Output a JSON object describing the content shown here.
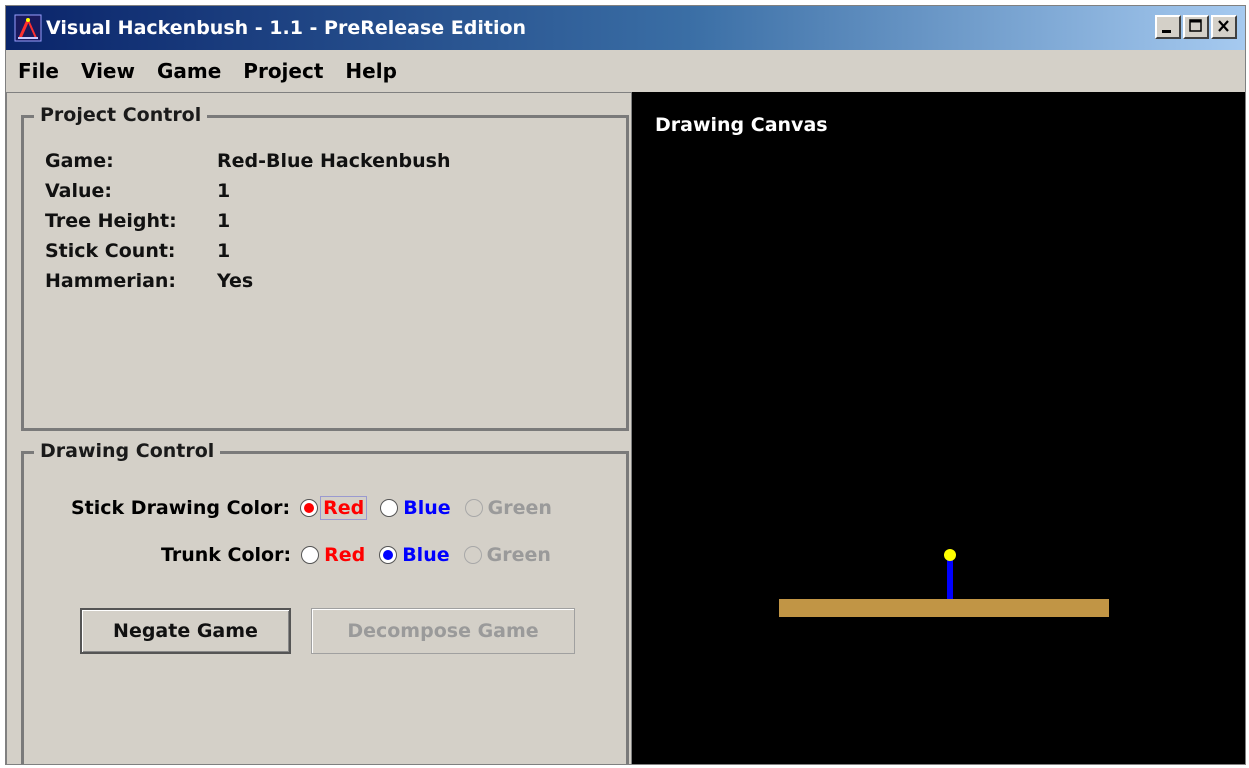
{
  "window": {
    "title": "Visual Hackenbush - 1.1 - PreRelease Edition"
  },
  "menu": {
    "items": [
      {
        "label": "File"
      },
      {
        "label": "View"
      },
      {
        "label": "Game"
      },
      {
        "label": "Project"
      },
      {
        "label": "Help"
      }
    ]
  },
  "project_control": {
    "title": "Project Control",
    "rows": [
      {
        "label": "Game:",
        "value": "Red-Blue Hackenbush"
      },
      {
        "label": "Value:",
        "value": "1"
      },
      {
        "label": "Tree Height:",
        "value": "1"
      },
      {
        "label": "Stick Count:",
        "value": "1"
      },
      {
        "label": "Hammerian:",
        "value": "Yes"
      }
    ]
  },
  "drawing_control": {
    "title": "Drawing Control",
    "stick_color": {
      "label": "Stick Drawing Color:",
      "options": [
        "Red",
        "Blue",
        "Green"
      ],
      "selected": "Red"
    },
    "trunk_color": {
      "label": "Trunk Color:",
      "options": [
        "Red",
        "Blue",
        "Green"
      ],
      "selected": "Blue"
    },
    "negate_button": "Negate Game",
    "decompose_button": "Decompose Game"
  },
  "canvas": {
    "title": "Drawing Canvas",
    "ground_color": "#c19545",
    "stick_color": "#0000ff",
    "node_color": "#ffff00"
  },
  "colors": {
    "red": "#ff0000",
    "blue": "#0000ff",
    "disabled_text": "#9a9a9a"
  }
}
